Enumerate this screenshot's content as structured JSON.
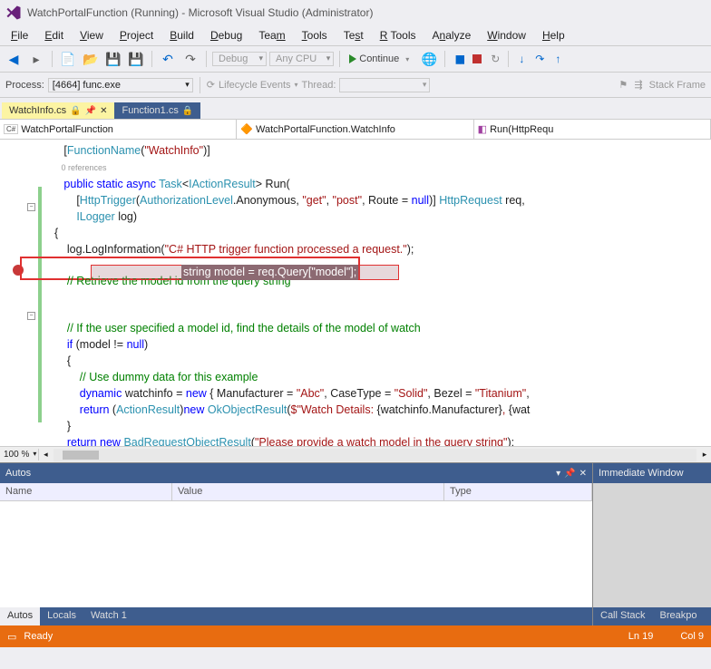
{
  "title": "WatchPortalFunction (Running) - Microsoft Visual Studio  (Administrator)",
  "menu": [
    "File",
    "Edit",
    "View",
    "Project",
    "Build",
    "Debug",
    "Team",
    "Tools",
    "Test",
    "R Tools",
    "Analyze",
    "Window",
    "Help"
  ],
  "toolbar": {
    "config": "Debug",
    "platform": "Any CPU",
    "continue": "Continue"
  },
  "process": {
    "label": "Process:",
    "value": "[4664] func.exe",
    "lifecycle": "Lifecycle Events",
    "thread": "Thread:",
    "stackframe": "Stack Frame"
  },
  "tabs": {
    "active": "WatchInfo.cs",
    "other": "Function1.cs"
  },
  "nav": {
    "left": "WatchPortalFunction",
    "mid": "WatchPortalFunction.WatchInfo",
    "right": "Run(HttpRequ"
  },
  "code": {
    "l1a": "[",
    "l1b": "FunctionName",
    "l1c": "(",
    "l1d": "\"WatchInfo\"",
    "l1e": ")]",
    "ref": "0 references",
    "l2a": "public static async ",
    "l2b": "Task",
    "l2c": "<",
    "l2d": "IActionResult",
    "l2e": "> Run(",
    "l3a": "    [",
    "l3b": "HttpTrigger",
    "l3c": "(",
    "l3d": "AuthorizationLevel",
    "l3e": ".Anonymous, ",
    "l3f": "\"get\"",
    "l3g": ", ",
    "l3h": "\"post\"",
    "l3i": ", Route = ",
    "l3j": "null",
    "l3k": ")] ",
    "l3l": "HttpRequest",
    "l3m": " req,",
    "l4a": "    ",
    "l4b": "ILogger",
    "l4c": " log)",
    "l5": "{",
    "l6a": "    log.LogInformation(",
    "l6b": "\"C# HTTP trigger function processed a request.\"",
    "l6c": ");",
    "l8": "    // Retrieve the model id from the query string",
    "l9": "string model = req.Query[\"model\"];",
    "l11": "    // If the user specified a model id, find the details of the model of watch",
    "l12a": "    if",
    "l12b": " (model != ",
    "l12c": "null",
    "l12d": ")",
    "l13": "    {",
    "l14": "        // Use dummy data for this example",
    "l15a": "        dynamic",
    "l15b": " watchinfo = ",
    "l15c": "new",
    "l15d": " { Manufacturer = ",
    "l15e": "\"Abc\"",
    "l15f": ", CaseType = ",
    "l15g": "\"Solid\"",
    "l15h": ", Bezel = ",
    "l15i": "\"Titanium\"",
    "l15j": ",",
    "l16a": "        return",
    "l16b": " (",
    "l16c": "ActionResult",
    "l16d": ")",
    "l16e": "new ",
    "l16f": "OkObjectResult",
    "l16g": "(",
    "l16h": "$\"Watch Details: ",
    "l16i": "{watchinfo.Manufacturer}",
    "l16j": ", ",
    "l16k": "{wat",
    "l17": "    }",
    "l18a": "    return new ",
    "l18b": "BadRequestObjectResult",
    "l18c": "(",
    "l18d": "\"Please provide a watch model in the query string\"",
    "l18e": ");",
    "l19": "}"
  },
  "zoom": "100 %",
  "panels": {
    "autos": "Autos",
    "immediate": "Immediate Window",
    "cols": {
      "name": "Name",
      "value": "Value",
      "type": "Type"
    },
    "tabs": {
      "autos": "Autos",
      "locals": "Locals",
      "watch1": "Watch 1",
      "callstack": "Call Stack",
      "breakpo": "Breakpo"
    }
  },
  "status": {
    "ready": "Ready",
    "ln": "Ln 19",
    "col": "Col 9"
  }
}
